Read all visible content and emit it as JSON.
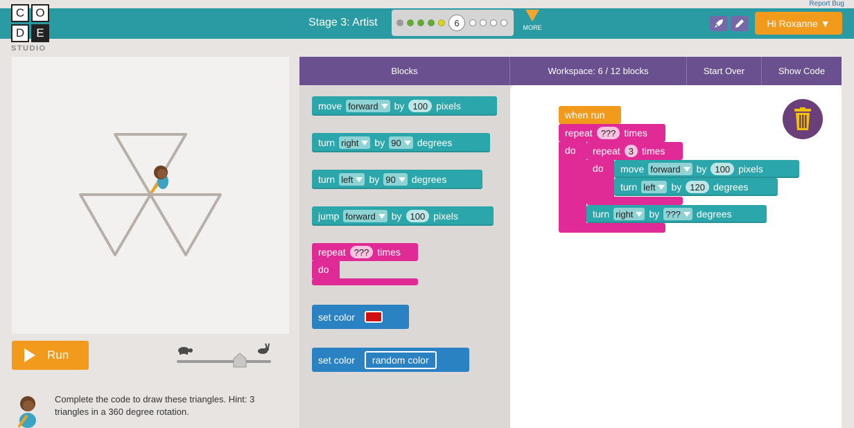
{
  "header": {
    "report_bug": "Report Bug",
    "logo_letters": [
      "C",
      "O",
      "D",
      "E"
    ],
    "logo_text": "STUDIO",
    "stage_title": "Stage 3: Artist",
    "current_level": "6",
    "more_label": "MORE",
    "user_button": "Hi Roxanne ▼",
    "rocket_icon": "rocket-icon",
    "pencil_icon": "pencil-icon"
  },
  "colors": {
    "teal_bar": "#2a9ba3",
    "orange": "#f29a1b",
    "purple_header": "#6b5090",
    "block_teal": "#2ba7ab",
    "block_blue": "#2a82c3",
    "block_pink": "#e02b96",
    "block_orange": "#f29a1b",
    "set_color_red": "#d20f0f"
  },
  "controls": {
    "run_label": "Run",
    "speed_slow_icon": "turtle-icon",
    "speed_fast_icon": "rabbit-icon",
    "speed_level": 0.75
  },
  "instructions": "Complete the code to draw these triangles. Hint: 3 triangles in a 360 degree rotation.",
  "workspace_header": {
    "blocks_tab": "Blocks",
    "workspace_status": "Workspace: 6 / 12 blocks",
    "start_over": "Start Over",
    "show_code": "Show Code"
  },
  "toolbox": {
    "move": {
      "label": "move",
      "dir": "forward",
      "by": "by",
      "value": "100",
      "unit": "pixels"
    },
    "turn_right": {
      "label": "turn",
      "dir": "right",
      "by": "by",
      "value": "90",
      "unit": "degrees"
    },
    "turn_left": {
      "label": "turn",
      "dir": "left",
      "by": "by",
      "value": "90",
      "unit": "degrees"
    },
    "jump": {
      "label": "jump",
      "dir": "forward",
      "by": "by",
      "value": "100",
      "unit": "pixels"
    },
    "repeat": {
      "label": "repeat",
      "value": "???",
      "times": "times",
      "do": "do"
    },
    "set_color_1": {
      "label": "set color"
    },
    "set_color_2": {
      "label": "set color",
      "value": "random color"
    }
  },
  "program": {
    "when_run": "when run",
    "outer_repeat": {
      "label": "repeat",
      "value": "???",
      "times": "times",
      "do": "do"
    },
    "inner_repeat": {
      "label": "repeat",
      "value": "3",
      "times": "times",
      "do": "do"
    },
    "move": {
      "label": "move",
      "dir": "forward",
      "by": "by",
      "value": "100",
      "unit": "pixels"
    },
    "turn_left": {
      "label": "turn",
      "dir": "left",
      "by": "by",
      "value": "120",
      "unit": "degrees"
    },
    "turn_right": {
      "label": "turn",
      "dir": "right",
      "by": "by",
      "value": "???",
      "unit": "degrees"
    }
  },
  "trash_icon": "trash-icon"
}
